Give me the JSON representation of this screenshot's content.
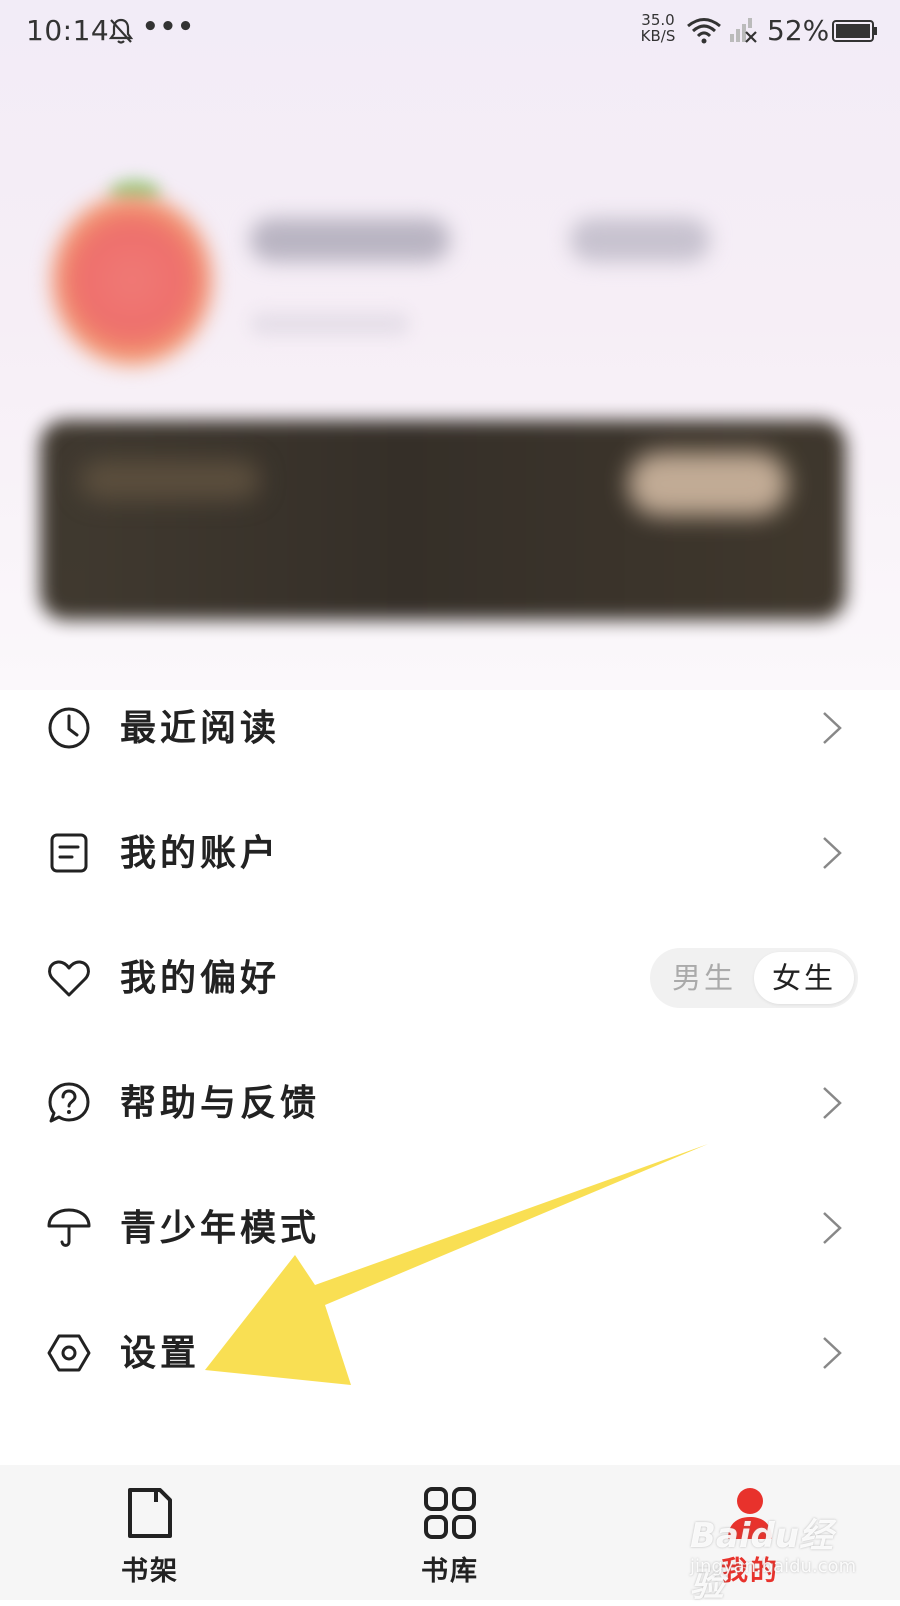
{
  "status_bar": {
    "time": "10:14",
    "dots": "•••",
    "speed_value": "35.0",
    "speed_unit": "KB/S",
    "battery": "52%"
  },
  "menu": {
    "items": [
      {
        "label": "最近阅读",
        "icon": "clock-icon"
      },
      {
        "label": "我的账户",
        "icon": "document-icon"
      },
      {
        "label": "我的偏好",
        "icon": "heart-icon"
      },
      {
        "label": "帮助与反馈",
        "icon": "question-bubble-icon"
      },
      {
        "label": "青少年模式",
        "icon": "umbrella-icon"
      },
      {
        "label": "设置",
        "icon": "settings-hexagon-icon"
      }
    ],
    "gender": {
      "male": "男生",
      "female": "女生",
      "selected": "女生"
    }
  },
  "bottom_nav": {
    "items": [
      {
        "label": "书架",
        "icon": "bookshelf-icon"
      },
      {
        "label": "书库",
        "icon": "grid-icon"
      },
      {
        "label": "我的",
        "icon": "profile-icon",
        "active": true
      }
    ]
  },
  "watermark": {
    "main": "Baidu经验",
    "sub": "jingyan.baidu.com"
  },
  "colors": {
    "accent": "#e8322c",
    "arrow": "#f9dd4a"
  }
}
